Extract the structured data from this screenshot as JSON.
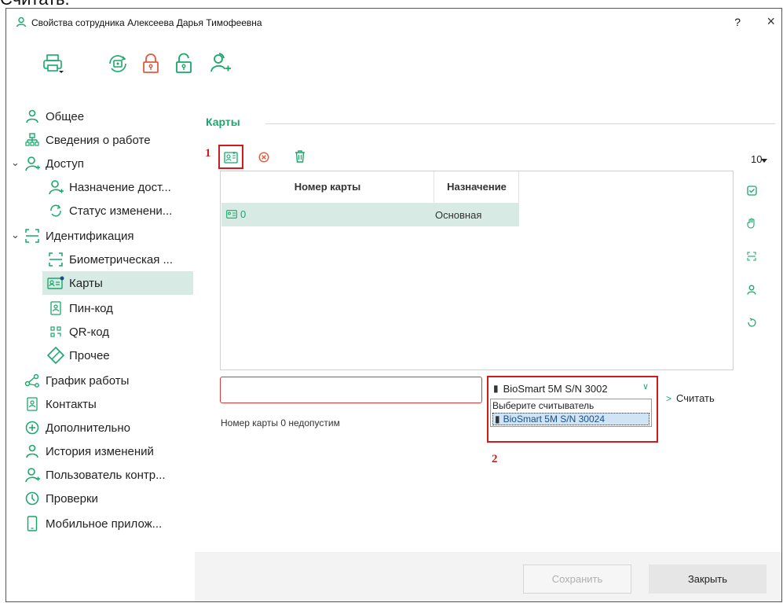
{
  "above_text": "Считать.",
  "window": {
    "title": "Свойства сотрудника Алексеева Дарья Тимофеевна",
    "help_label": "?",
    "close_label": "×"
  },
  "toolbar": {
    "buttons": [
      "printer-icon",
      "fingerprint-icon",
      "lock-icon",
      "unlock-icon",
      "add-user-icon"
    ]
  },
  "sidebar": {
    "items": [
      {
        "label": "Общее",
        "icon": "user-icon"
      },
      {
        "label": "Сведения о работе",
        "icon": "org-icon"
      },
      {
        "label": "Доступ",
        "icon": "access-icon",
        "expanded": true
      },
      {
        "label": "Назначение дост...",
        "icon": "access-icon"
      },
      {
        "label": "Статус изменени...",
        "icon": "sync-icon"
      },
      {
        "label": "Идентификация",
        "icon": "scan-icon",
        "expanded": true
      },
      {
        "label": "Биометрическая ...",
        "icon": "scan-icon"
      },
      {
        "label": "Карты",
        "icon": "card-icon",
        "selected": true
      },
      {
        "label": "Пин-код",
        "icon": "pin-icon"
      },
      {
        "label": "QR-код",
        "icon": "qr-icon"
      },
      {
        "label": "Прочее",
        "icon": "tag-icon"
      },
      {
        "label": "График работы",
        "icon": "schedule-icon"
      },
      {
        "label": "Контакты",
        "icon": "contacts-icon"
      },
      {
        "label": "Дополнительно",
        "icon": "plus-circle-icon"
      },
      {
        "label": "История изменений",
        "icon": "user-icon"
      },
      {
        "label": "Пользователь контр...",
        "icon": "user-add-icon"
      },
      {
        "label": "Проверки",
        "icon": "clock-icon"
      },
      {
        "label": "Мобильное прилож...",
        "icon": "phone-icon"
      }
    ]
  },
  "main": {
    "section_title": "Карты",
    "page_size": "10",
    "marker_1": "1",
    "marker_2": "2",
    "table": {
      "columns": [
        "Номер карты",
        "Назначение"
      ],
      "rows": [
        {
          "number": "0",
          "purpose": "Основная"
        }
      ]
    },
    "card_input": {
      "value": "",
      "placeholder": ""
    },
    "error_text": "Номер карты 0 недопустим",
    "reader": {
      "selected": "BioSmart 5M S/N 3002⁣",
      "options": [
        "Выберите считыватель",
        "BioSmart 5M S/N 30024"
      ]
    },
    "read_button": "Считать"
  },
  "footer": {
    "save_label": "Сохранить",
    "close_label": "Закрыть"
  },
  "colors": {
    "accent": "#18a86b",
    "selected_bg": "#d7ebe4",
    "alert_red": "#d11a1a",
    "danger_lock": "#e05a3a"
  }
}
